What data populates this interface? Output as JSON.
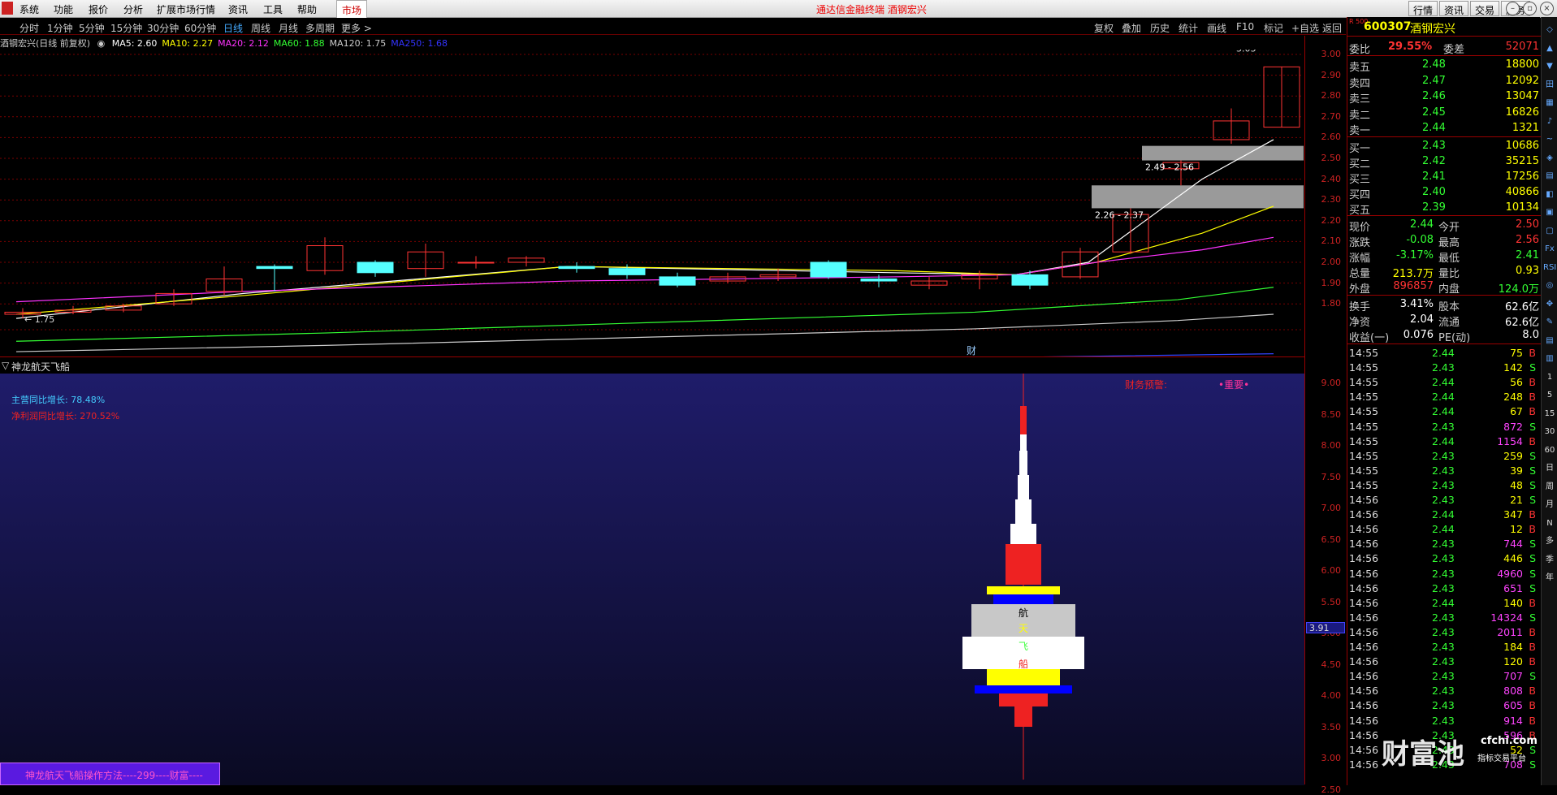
{
  "menubar": {
    "items": [
      "系统",
      "功能",
      "报价",
      "分析",
      "扩展市场行情",
      "资讯",
      "工具",
      "帮助"
    ],
    "market_tab": "市场",
    "title": "通达信金融终端 酒钢宏兴",
    "right_buttons": [
      "行情",
      "资讯",
      "交易",
      "服务"
    ]
  },
  "period_bar": {
    "items": [
      "分时",
      "1分钟",
      "5分钟",
      "15分钟",
      "30分钟",
      "60分钟",
      "日线",
      "周线",
      "月线",
      "多周期",
      "更多 >"
    ],
    "active": "日线",
    "tools": [
      "复权",
      "叠加",
      "历史",
      "统计",
      "画线",
      "F10",
      "标记",
      "+自选",
      "返回"
    ]
  },
  "ma_legend": {
    "name": "酒钢宏兴(日线 前复权)",
    "items": [
      {
        "label": "MA5: 2.60",
        "color": "#ffffff"
      },
      {
        "label": "MA10: 2.27",
        "color": "#ffff00"
      },
      {
        "label": "MA20: 2.12",
        "color": "#ff33ff"
      },
      {
        "label": "MA60: 1.88",
        "color": "#33ff33"
      },
      {
        "label": "MA120: 1.75",
        "color": "#cccccc"
      },
      {
        "label": "MA250: 1.68",
        "color": "#3333ff"
      }
    ]
  },
  "price_axis": [
    "3.00",
    "2.90",
    "2.80",
    "2.70",
    "2.60",
    "2.50",
    "2.40",
    "2.30",
    "2.20",
    "2.10",
    "2.00",
    "1.90",
    "1.80"
  ],
  "annotations": {
    "high": "3.03",
    "low": "1.75",
    "zone1": "2.49 - 2.56",
    "zone2": "2.26 - 2.37",
    "cai": "财"
  },
  "candles": [
    {
      "o": 1.75,
      "c": 1.76,
      "h": 1.78,
      "l": 1.73
    },
    {
      "o": 1.76,
      "c": 1.77,
      "h": 1.79,
      "l": 1.75
    },
    {
      "o": 1.77,
      "c": 1.79,
      "h": 1.8,
      "l": 1.76
    },
    {
      "o": 1.8,
      "c": 1.85,
      "h": 1.87,
      "l": 1.79
    },
    {
      "o": 1.86,
      "c": 1.92,
      "h": 1.98,
      "l": 1.84
    },
    {
      "o": 1.98,
      "c": 1.97,
      "h": 1.99,
      "l": 1.86
    },
    {
      "o": 1.96,
      "c": 2.08,
      "h": 2.12,
      "l": 1.94
    },
    {
      "o": 2.0,
      "c": 1.95,
      "h": 2.01,
      "l": 1.93
    },
    {
      "o": 1.97,
      "c": 2.05,
      "h": 2.09,
      "l": 1.93
    },
    {
      "o": 2.0,
      "c": 2.0,
      "h": 2.03,
      "l": 1.97
    },
    {
      "o": 2.0,
      "c": 2.02,
      "h": 2.03,
      "l": 1.98
    },
    {
      "o": 1.98,
      "c": 1.97,
      "h": 2.0,
      "l": 1.95
    },
    {
      "o": 1.97,
      "c": 1.94,
      "h": 1.99,
      "l": 1.92
    },
    {
      "o": 1.93,
      "c": 1.89,
      "h": 1.95,
      "l": 1.88
    },
    {
      "o": 1.91,
      "c": 1.93,
      "h": 1.95,
      "l": 1.9
    },
    {
      "o": 1.93,
      "c": 1.94,
      "h": 1.97,
      "l": 1.91
    },
    {
      "o": 2.0,
      "c": 1.93,
      "h": 2.01,
      "l": 1.92
    },
    {
      "o": 1.92,
      "c": 1.91,
      "h": 1.94,
      "l": 1.88
    },
    {
      "o": 1.89,
      "c": 1.91,
      "h": 1.93,
      "l": 1.87
    },
    {
      "o": 1.92,
      "c": 1.94,
      "h": 1.96,
      "l": 1.87
    },
    {
      "o": 1.94,
      "c": 1.89,
      "h": 1.96,
      "l": 1.87
    },
    {
      "o": 1.93,
      "c": 2.05,
      "h": 2.07,
      "l": 1.92
    },
    {
      "o": 2.05,
      "c": 2.23,
      "h": 2.26,
      "l": 2.04
    },
    {
      "o": 2.45,
      "c": 2.48,
      "h": 2.49,
      "l": 2.37
    },
    {
      "o": 2.59,
      "c": 2.68,
      "h": 2.74,
      "l": 2.57
    },
    {
      "o": 2.65,
      "c": 2.94,
      "h": 2.94,
      "l": 2.65
    },
    {
      "o": 2.94,
      "c": 2.66,
      "h": 3.03,
      "l": 2.63
    }
  ],
  "lower_panel": {
    "title": "神龙航天飞船",
    "line1": "主营同比增长: 78.48%",
    "line2": "净利润同比增长: 270.52%",
    "warn1": "财务预警:",
    "warn2": "•重要•",
    "rocket_chars": [
      "航",
      "天",
      "飞",
      "船"
    ],
    "footer": "神龙航天飞船操作方法----299----财富----",
    "current_tag": "3.91",
    "axis": [
      "9.00",
      "8.50",
      "8.00",
      "7.50",
      "7.00",
      "6.50",
      "6.00",
      "5.50",
      "5.00",
      "4.50",
      "4.00",
      "3.50",
      "3.00",
      "2.50"
    ]
  },
  "quote": {
    "mark": "R 500",
    "code": "600307",
    "name": "酒钢宏兴",
    "webi": {
      "label": "委比",
      "value": "29.55%",
      "label2": "委差",
      "value2": "52071"
    },
    "asks": [
      {
        "label": "卖五",
        "price": "2.48",
        "vol": "18800"
      },
      {
        "label": "卖四",
        "price": "2.47",
        "vol": "12092"
      },
      {
        "label": "卖三",
        "price": "2.46",
        "vol": "13047"
      },
      {
        "label": "卖二",
        "price": "2.45",
        "vol": "16826"
      },
      {
        "label": "卖一",
        "price": "2.44",
        "vol": "1321"
      }
    ],
    "bids": [
      {
        "label": "买一",
        "price": "2.43",
        "vol": "10686"
      },
      {
        "label": "买二",
        "price": "2.42",
        "vol": "35215"
      },
      {
        "label": "买三",
        "price": "2.41",
        "vol": "17256"
      },
      {
        "label": "买四",
        "price": "2.40",
        "vol": "40866"
      },
      {
        "label": "买五",
        "price": "2.39",
        "vol": "10134"
      }
    ],
    "stats": [
      [
        "现价",
        "2.44",
        "今开",
        "2.50"
      ],
      [
        "涨跌",
        "-0.08",
        "最高",
        "2.56"
      ],
      [
        "涨幅",
        "-3.17%",
        "最低",
        "2.41"
      ],
      [
        "总量",
        "213.7万",
        "量比",
        "0.93"
      ],
      [
        "外盘",
        "896857",
        "内盘",
        "124.0万"
      ]
    ],
    "stats2": [
      [
        "换手",
        "3.41%",
        "股本",
        "62.6亿"
      ],
      [
        "净资",
        "2.04",
        "流通",
        "62.6亿"
      ],
      [
        "收益(一)",
        "0.076",
        "PE(动)",
        "8.0"
      ]
    ],
    "ticks": [
      [
        "14:55",
        "2.44",
        "75",
        "B"
      ],
      [
        "14:55",
        "2.43",
        "142",
        "S"
      ],
      [
        "14:55",
        "2.44",
        "56",
        "B"
      ],
      [
        "14:55",
        "2.44",
        "248",
        "B"
      ],
      [
        "14:55",
        "2.44",
        "67",
        "B"
      ],
      [
        "14:55",
        "2.43",
        "872",
        "S"
      ],
      [
        "14:55",
        "2.44",
        "1154",
        "B"
      ],
      [
        "14:55",
        "2.43",
        "259",
        "S"
      ],
      [
        "14:55",
        "2.43",
        "39",
        "S"
      ],
      [
        "14:55",
        "2.43",
        "48",
        "S"
      ],
      [
        "14:56",
        "2.43",
        "21",
        "S"
      ],
      [
        "14:56",
        "2.44",
        "347",
        "B"
      ],
      [
        "14:56",
        "2.44",
        "12",
        "B"
      ],
      [
        "14:56",
        "2.43",
        "744",
        "S"
      ],
      [
        "14:56",
        "2.43",
        "446",
        "S"
      ],
      [
        "14:56",
        "2.43",
        "4960",
        "S"
      ],
      [
        "14:56",
        "2.43",
        "651",
        "S"
      ],
      [
        "14:56",
        "2.44",
        "140",
        "B"
      ],
      [
        "14:56",
        "2.43",
        "14324",
        "S"
      ],
      [
        "14:56",
        "2.43",
        "2011",
        "B"
      ],
      [
        "14:56",
        "2.43",
        "184",
        "B"
      ],
      [
        "14:56",
        "2.43",
        "120",
        "B"
      ],
      [
        "14:56",
        "2.43",
        "707",
        "S"
      ],
      [
        "14:56",
        "2.43",
        "808",
        "B"
      ],
      [
        "14:56",
        "2.43",
        "605",
        "B"
      ],
      [
        "14:56",
        "2.43",
        "914",
        "B"
      ],
      [
        "14:56",
        "2.43",
        "596",
        "B"
      ],
      [
        "14:56",
        "2.43",
        "52",
        "S"
      ],
      [
        "14:56",
        "2.43",
        "708",
        "S"
      ]
    ],
    "watermark": "财富池",
    "watermark_sub1": "cfchi.com",
    "watermark_sub2": "指标交易平台"
  },
  "side_icons": [
    "◇",
    "▲",
    "▼",
    "田",
    "▦",
    "♪",
    "~",
    "◈",
    "▤",
    "◧",
    "▣",
    "▢",
    "Fx",
    "RSI",
    "◎",
    "✥",
    "✎",
    "▤",
    "▥",
    "1",
    "5",
    "15",
    "30",
    "60",
    "日",
    "周",
    "月",
    "N",
    "多",
    "季",
    "年"
  ]
}
